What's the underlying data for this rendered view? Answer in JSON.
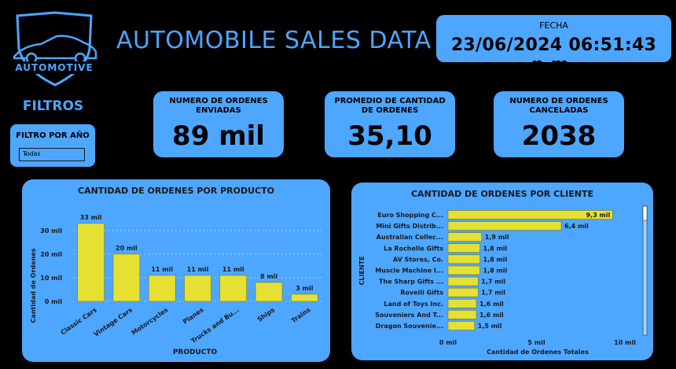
{
  "logo": {
    "text": "AUTOMOTIVE"
  },
  "header": {
    "title": "AUTOMOBILE SALES DATA"
  },
  "date": {
    "label": "FECHA",
    "value": "23/06/2024 06:51:43 p.m."
  },
  "filters": {
    "title": "FILTROS",
    "year_label": "FILTRO POR AÑO",
    "year_value": "Todas"
  },
  "kpis": [
    {
      "label": "NUMERO DE ORDENES ENVIADAS",
      "value": "89 mil"
    },
    {
      "label": "PROMEDIO DE CANTIDAD DE ORDENES",
      "value": "35,10"
    },
    {
      "label": "NUMERO DE ORDENES CANCELADAS",
      "value": "2038"
    }
  ],
  "colors": {
    "accent": "#4da6ff",
    "bar": "#e6e033",
    "background": "#000000"
  },
  "chart_data": [
    {
      "type": "bar",
      "title": "CANTIDAD DE ORDENES POR PRODUCTO",
      "xlabel": "PRODUCTO",
      "ylabel": "Cantidad de Ordenes",
      "categories": [
        "Classic Cars",
        "Vintage Cars",
        "Motorcycles",
        "Planes",
        "Trucks and Bu...",
        "Ships",
        "Trains"
      ],
      "values": [
        33,
        20,
        11,
        11,
        11,
        8,
        3
      ],
      "data_labels": [
        "33 mil",
        "20 mil",
        "11 mil",
        "11 mil",
        "11 mil",
        "8 mil",
        "3 mil"
      ],
      "yticks": [
        "0 mil",
        "10 mil",
        "20 mil",
        "30 mil"
      ],
      "ylim": [
        0,
        35
      ],
      "grid": true
    },
    {
      "type": "bar",
      "orientation": "horizontal",
      "title": "CANTIDAD DE ORDENES POR CLIENTE",
      "xlabel": "Cantidad de Ordenes Totales",
      "ylabel": "CLIENTE",
      "categories": [
        "Euro Shopping C...",
        "Mini Gifts Distrib...",
        "Australian Collec...",
        "La Rochelle Gifts",
        "AV Stores, Co.",
        "Muscle Machine I...",
        "The Sharp Gifts ...",
        "Rovelli Gifts",
        "Land of Toys Inc.",
        "Souveniers And T...",
        "Dragon Souvenie..."
      ],
      "values": [
        9.3,
        6.4,
        1.9,
        1.8,
        1.8,
        1.8,
        1.7,
        1.7,
        1.6,
        1.6,
        1.5
      ],
      "data_labels": [
        "9,3 mil",
        "6,4 mil",
        "1,9 mil",
        "1,8 mil",
        "1,8 mil",
        "1,8 mil",
        "1,7 mil",
        "1,7 mil",
        "1,6 mil",
        "1,6 mil",
        "1,5 mil"
      ],
      "xticks": [
        "0 mil",
        "5 mil",
        "10 mil"
      ],
      "xlim": [
        0,
        10
      ],
      "grid": false
    }
  ]
}
